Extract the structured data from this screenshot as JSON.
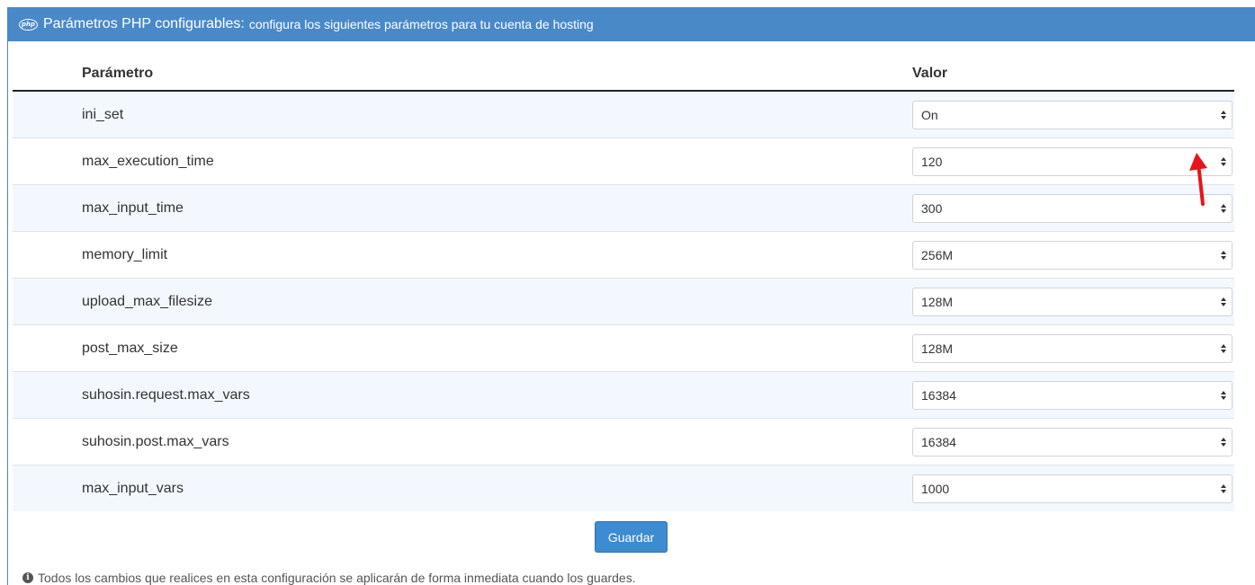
{
  "header": {
    "icon": "php-logo-icon",
    "icon_text": "php",
    "title": "Parámetros PHP configurables:",
    "subtitle": "configura los siguientes parámetros para tu cuenta de hosting"
  },
  "table": {
    "columns": [
      "Parámetro",
      "Valor"
    ],
    "rows": [
      {
        "param": "ini_set",
        "value": "On"
      },
      {
        "param": "max_execution_time",
        "value": "120"
      },
      {
        "param": "max_input_time",
        "value": "300"
      },
      {
        "param": "memory_limit",
        "value": "256M"
      },
      {
        "param": "upload_max_filesize",
        "value": "128M"
      },
      {
        "param": "post_max_size",
        "value": "128M"
      },
      {
        "param": "suhosin.request.max_vars",
        "value": "16384"
      },
      {
        "param": "suhosin.post.max_vars",
        "value": "16384"
      },
      {
        "param": "max_input_vars",
        "value": "1000"
      }
    ]
  },
  "save_button": "Guardar",
  "note": {
    "icon": "info-circle-icon",
    "text": "Todos los cambios que realices en esta configuración se aplicarán de forma inmediata cuando los guardes."
  },
  "colors": {
    "header_bg": "#4a89c8",
    "row_stripe": "#f2f8fd",
    "button": "#3d8bd0",
    "annotation_arrow": "#e8141b"
  }
}
